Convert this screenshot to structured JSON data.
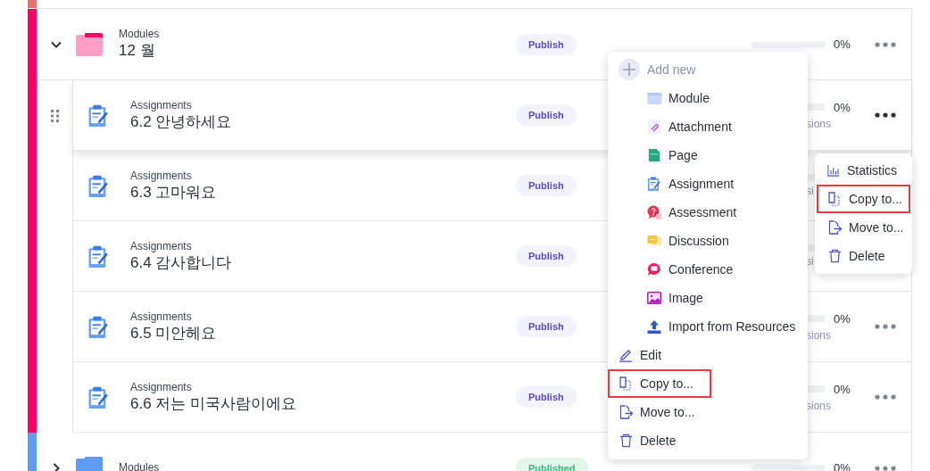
{
  "modules": [
    {
      "kind": "edge",
      "color": "#ea6f68"
    },
    {
      "kind": "module",
      "color": "#ff0066",
      "expanded": true,
      "label": "Modules",
      "title": "12 월",
      "status": "Publish",
      "published": false,
      "level": 0,
      "percent": "0%",
      "items": [
        {
          "kind": "assignment",
          "label": "Assignments",
          "title": "6.2 안녕하세요",
          "status": "Publish",
          "published": false,
          "hovered": true,
          "level": 0,
          "percent": "0%",
          "sub": "sions"
        },
        {
          "kind": "assignment",
          "label": "Assignments",
          "title": "6.3 고마워요",
          "status": "Publish",
          "published": false,
          "hovered": false,
          "level": 0,
          "sub": "si"
        },
        {
          "kind": "assignment",
          "label": "Assignments",
          "title": "6.4 감사합니다",
          "status": "Publish",
          "published": false,
          "hovered": false,
          "level": 0,
          "sub": "si"
        },
        {
          "kind": "assignment",
          "label": "Assignments",
          "title": "6.5 미안헤요",
          "status": "Publish",
          "published": false,
          "hovered": false,
          "level": 0,
          "percent": "0%",
          "sub": "sions"
        },
        {
          "kind": "assignment",
          "label": "Assignments",
          "title": "6.6 저는 미국사람이에요",
          "status": "Publish",
          "published": false,
          "hovered": false,
          "level": 0,
          "percent": "0%",
          "sub": "sions"
        }
      ]
    },
    {
      "kind": "module",
      "color": "#5c9cf5",
      "expanded": false,
      "label": "Modules",
      "status": "Published",
      "published": true,
      "level": 0,
      "percent": "0%"
    }
  ],
  "context_menu": {
    "add_new": "Add new",
    "add_items": [
      {
        "kind": "module",
        "label": "Module"
      },
      {
        "kind": "attachment",
        "label": "Attachment"
      },
      {
        "kind": "page",
        "label": "Page"
      },
      {
        "kind": "assignment",
        "label": "Assignment"
      },
      {
        "kind": "assessment",
        "label": "Assessment"
      },
      {
        "kind": "discussion",
        "label": "Discussion"
      },
      {
        "kind": "conference",
        "label": "Conference"
      },
      {
        "kind": "image",
        "label": "Image"
      },
      {
        "kind": "import",
        "label": "Import from Resources"
      }
    ],
    "actions": [
      {
        "kind": "edit",
        "label": "Edit",
        "highlighted": false
      },
      {
        "kind": "copy",
        "label": "Copy to...",
        "highlighted": true
      },
      {
        "kind": "move",
        "label": "Move to...",
        "highlighted": false
      },
      {
        "kind": "delete",
        "label": "Delete",
        "highlighted": false
      }
    ]
  },
  "item_menu": {
    "actions": [
      {
        "kind": "statistics",
        "label": "Statistics",
        "highlighted": false
      },
      {
        "kind": "copy",
        "label": "Copy to...",
        "highlighted": true
      },
      {
        "kind": "move",
        "label": "Move to...",
        "highlighted": false
      },
      {
        "kind": "delete",
        "label": "Delete",
        "highlighted": false
      }
    ]
  }
}
